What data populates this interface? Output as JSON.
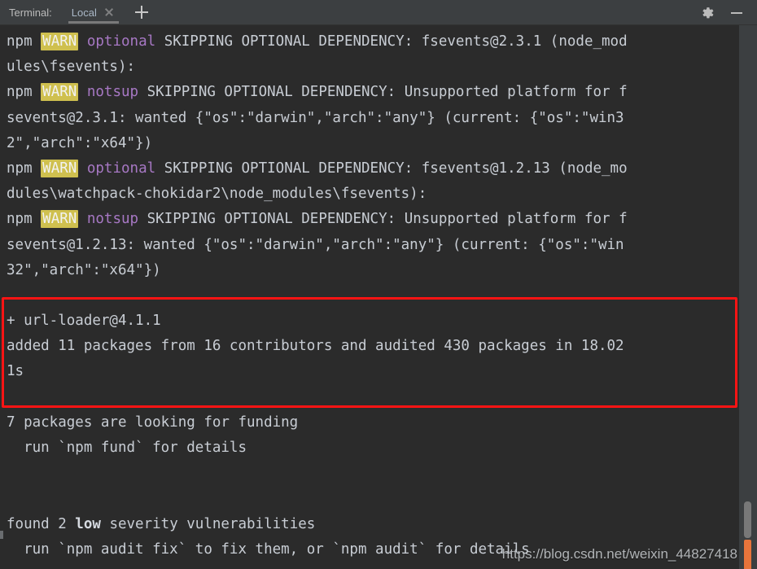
{
  "header": {
    "title": "Terminal:",
    "tab_label": "Local",
    "close_icon": "close-icon",
    "add_icon": "plus-icon",
    "gear_icon": "gear-icon",
    "minimize_icon": "minimize-icon"
  },
  "terminal": {
    "lines": [
      {
        "segments": [
          {
            "text": "npm ",
            "style": "plain"
          },
          {
            "text": "WARN",
            "style": "warn"
          },
          {
            "text": " ",
            "style": "plain"
          },
          {
            "text": "optional",
            "style": "purple"
          },
          {
            "text": " SKIPPING OPTIONAL DEPENDENCY: fsevents@2.3.1 (node_mod",
            "style": "plain"
          }
        ]
      },
      {
        "segments": [
          {
            "text": "ules\\fsevents):",
            "style": "plain"
          }
        ]
      },
      {
        "segments": [
          {
            "text": "npm ",
            "style": "plain"
          },
          {
            "text": "WARN",
            "style": "warn"
          },
          {
            "text": " ",
            "style": "plain"
          },
          {
            "text": "notsup",
            "style": "purple"
          },
          {
            "text": " SKIPPING OPTIONAL DEPENDENCY: Unsupported platform for f",
            "style": "plain"
          }
        ]
      },
      {
        "segments": [
          {
            "text": "sevents@2.3.1: wanted {\"os\":\"darwin\",\"arch\":\"any\"} (current: {\"os\":\"win3",
            "style": "plain"
          }
        ]
      },
      {
        "segments": [
          {
            "text": "2\",\"arch\":\"x64\"})",
            "style": "plain"
          }
        ]
      },
      {
        "segments": [
          {
            "text": "npm ",
            "style": "plain"
          },
          {
            "text": "WARN",
            "style": "warn"
          },
          {
            "text": " ",
            "style": "plain"
          },
          {
            "text": "optional",
            "style": "purple"
          },
          {
            "text": " SKIPPING OPTIONAL DEPENDENCY: fsevents@1.2.13 (node_mo",
            "style": "plain"
          }
        ]
      },
      {
        "segments": [
          {
            "text": "dules\\watchpack-chokidar2\\node_modules\\fsevents):",
            "style": "plain"
          }
        ]
      },
      {
        "segments": [
          {
            "text": "npm ",
            "style": "plain"
          },
          {
            "text": "WARN",
            "style": "warn"
          },
          {
            "text": " ",
            "style": "plain"
          },
          {
            "text": "notsup",
            "style": "purple"
          },
          {
            "text": " SKIPPING OPTIONAL DEPENDENCY: Unsupported platform for f",
            "style": "plain"
          }
        ]
      },
      {
        "segments": [
          {
            "text": "sevents@1.2.13: wanted {\"os\":\"darwin\",\"arch\":\"any\"} (current: {\"os\":\"win",
            "style": "plain"
          }
        ]
      },
      {
        "segments": [
          {
            "text": "32\",\"arch\":\"x64\"})",
            "style": "plain"
          }
        ]
      },
      {
        "segments": [
          {
            "text": "",
            "style": "plain"
          }
        ]
      },
      {
        "segments": [
          {
            "text": "+ url-loader@4.1.1",
            "style": "plain"
          }
        ]
      },
      {
        "segments": [
          {
            "text": "added 11 packages from 16 contributors and audited 430 packages in 18.02",
            "style": "plain"
          }
        ]
      },
      {
        "segments": [
          {
            "text": "1s",
            "style": "plain"
          }
        ]
      },
      {
        "segments": [
          {
            "text": "",
            "style": "plain"
          }
        ]
      },
      {
        "segments": [
          {
            "text": "7 packages are looking for funding",
            "style": "plain"
          }
        ]
      },
      {
        "segments": [
          {
            "text": "  run `npm fund` for details",
            "style": "plain"
          }
        ]
      },
      {
        "segments": [
          {
            "text": "",
            "style": "plain"
          }
        ]
      },
      {
        "segments": [
          {
            "text": "",
            "style": "plain"
          }
        ]
      },
      {
        "segments": [
          {
            "text": "found 2 ",
            "style": "plain"
          },
          {
            "text": "low",
            "style": "bold"
          },
          {
            "text": " severity vulnerabilities",
            "style": "plain"
          }
        ]
      },
      {
        "segments": [
          {
            "text": "  run `npm audit fix` to fix them, or `npm audit` for details",
            "style": "plain"
          }
        ]
      }
    ]
  },
  "annotation": {
    "kind": "red-highlight-box"
  },
  "scrollbar": {
    "thumb": "scroll-thumb",
    "marker": "scroll-error-marker"
  },
  "watermark": {
    "text": "https://blog.csdn.net/weixin_44827418"
  },
  "colors": {
    "background": "#2b2b2b",
    "header_background": "#3c3f41",
    "text": "#c8cdd4",
    "warn_badge": "#cfc04f",
    "purple": "#a778c4",
    "annotation_red": "#fb1414",
    "scroll_marker_orange": "#e8743b"
  }
}
